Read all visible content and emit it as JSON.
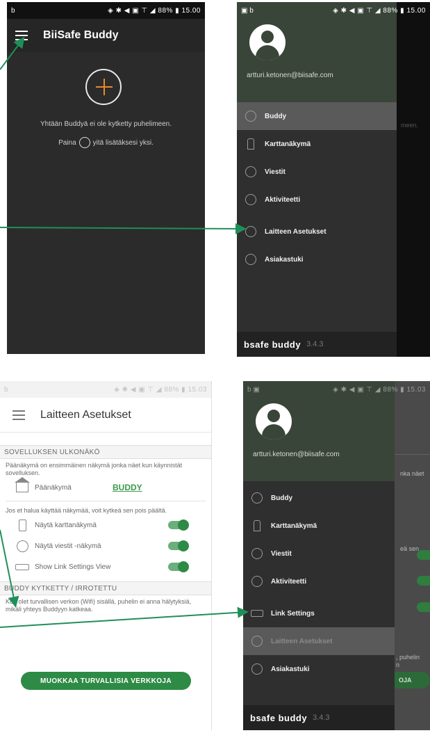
{
  "colors": {
    "accent_green": "#2e8b45",
    "arrow_green": "#1f8f5a",
    "plus_orange": "#e98a2b",
    "drawer_header": "#394539"
  },
  "phone_main": {
    "status": {
      "left": "b",
      "right": "◈ ✱ ◀ ▣ ⊤ ◢ 88% ▮ 15.00"
    },
    "app_title": "BiiSafe Buddy",
    "message_line1": "Yhtään Buddyä ei ole kytketty puhelimeen.",
    "message_part_a": "Paina",
    "message_part_b": "yitä lisätäksesi yksi."
  },
  "drawer_top": {
    "status": {
      "left": "▣ b",
      "right": "◈ ✱ ◀ ▣ ⊤ ◢ 88% ▮ 15.00"
    },
    "email": "artturi.ketonen@biisafe.com",
    "peek_text": "meen.",
    "items": [
      {
        "label": "Buddy",
        "icon": "buddy-icon"
      },
      {
        "label": "Karttanäkymä",
        "icon": "map-icon"
      },
      {
        "label": "Viestit",
        "icon": "messages-icon"
      },
      {
        "label": "Aktiviteetti",
        "icon": "activity-icon"
      },
      {
        "label": "Laitteen Asetukset",
        "icon": "device-settings-icon"
      },
      {
        "label": "Asiakastuki",
        "icon": "support-icon"
      }
    ],
    "brand": "bsafe buddy",
    "version": "3.4.3"
  },
  "settings": {
    "status": {
      "left": "b",
      "right": "◈ ✱ ◀ ▣ ⊤ ◢ 88% ▮ 15.03"
    },
    "title": "Laitteen Asetukset",
    "section1_title": "SOVELLUKSEN ULKONÄKÖ",
    "section1_desc": "Päänäkymä on ensimmäinen näkymä jonka näet kun käynnistät sovelluksen.",
    "main_view_label": "Päänäkymä",
    "main_view_value": "BUDDY",
    "toggle_desc": "Jos et halua käyttää näkymää, voit kytkeä sen pois päältä.",
    "toggles": [
      {
        "label": "Näytä karttanäkymä",
        "on": true
      },
      {
        "label": "Näytä viestit -näkymä",
        "on": true
      },
      {
        "label": "Show Link Settings View",
        "on": true
      }
    ],
    "section2_title": "BUDDY KYTKETTY / IRROTETTU",
    "section2_desc": "Kun olet turvallisen verkon (Wifi) sisällä, puhelin ei anna hälytyksiä, mikäli yhteys Buddyyn katkeaa.",
    "button": "MUOKKAA TURVALLISIA VERKKOJA"
  },
  "drawer_bottom": {
    "status": {
      "left": "b ▣",
      "right": "◈ ✱ ◀ ▣ ⊤ ◢ 88% ▮ 15.03"
    },
    "email": "artturi.ketonen@biisafe.com",
    "peek_text_1": "nka näet",
    "peek_text_2": "eä sen",
    "peek_text_3": ", puhelin",
    "peek_text_4": "n",
    "peek_button": "OJA",
    "items": [
      {
        "label": "Buddy",
        "icon": "buddy-icon"
      },
      {
        "label": "Karttanäkymä",
        "icon": "map-icon"
      },
      {
        "label": "Viestit",
        "icon": "messages-icon"
      },
      {
        "label": "Aktiviteetti",
        "icon": "activity-icon"
      },
      {
        "label": "Link Settings",
        "icon": "link-settings-icon"
      },
      {
        "label": "Laitteen Asetukset",
        "icon": "device-settings-icon"
      },
      {
        "label": "Asiakastuki",
        "icon": "support-icon"
      }
    ],
    "brand": "bsafe buddy",
    "version": "3.4.3"
  }
}
